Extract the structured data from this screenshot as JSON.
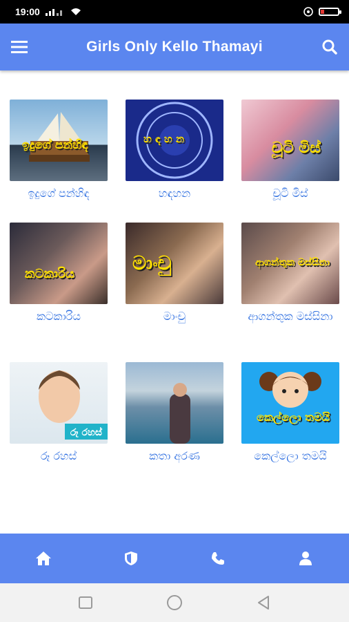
{
  "status": {
    "time": "19:00"
  },
  "app_bar": {
    "title": "Girls Only Kello Thamayi"
  },
  "items": [
    {
      "caption": "ඉදුගේ පන්හිඳ",
      "thumb_text": "ඉදුගේ පන්හිඳ"
    },
    {
      "caption": "හඳහන",
      "thumb_text": "හ ඳ හ න"
    },
    {
      "caption": "චූටි මිස්",
      "thumb_text": "චූටි මිස්"
    },
    {
      "caption": "කටකාරිය",
      "thumb_text": "කටකාරිය"
    },
    {
      "caption": "මාංචු",
      "thumb_text": "මාංචු"
    },
    {
      "caption": "ආගන්තුක මස්සිනා",
      "thumb_text": "ආගන්තුක මස්සිනා"
    },
    {
      "caption": "රූ රහස්",
      "thumb_text": "රූ රහස්"
    },
    {
      "caption": "කතා අරණ",
      "thumb_text": ""
    },
    {
      "caption": "කෙල්ලො තමයි",
      "thumb_text": "කෙල්ලො තමයි"
    }
  ],
  "bottom_nav": [
    "home-icon",
    "shield-icon",
    "phone-icon",
    "user-icon"
  ],
  "colors": {
    "primary": "#5b86ef",
    "caption": "#2f6fe0"
  }
}
